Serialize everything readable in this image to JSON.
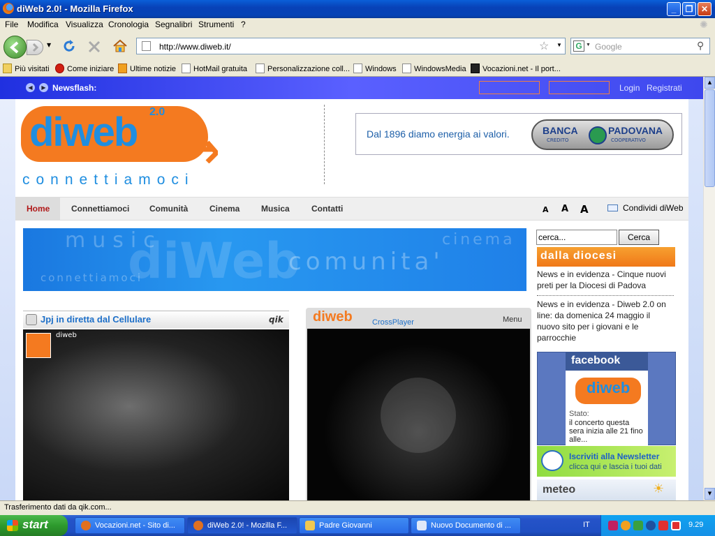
{
  "window": {
    "title": "diWeb 2.0! - Mozilla Firefox"
  },
  "menubar": [
    "File",
    "Modifica",
    "Visualizza",
    "Cronologia",
    "Segnalibri",
    "Strumenti",
    "?"
  ],
  "nav": {
    "url": "http://www.diweb.it/",
    "search_placeholder": "Google"
  },
  "bookmarks": [
    "Più visitati",
    "Come iniziare",
    "Ultime notizie",
    "HotMail gratuita",
    "Personalizzazione coll...",
    "Windows",
    "WindowsMedia",
    "Vocazioni.net - Il port..."
  ],
  "page": {
    "newsflash_label": "Newsflash:",
    "login": "Login",
    "register": "Registrati",
    "logo_main": "diweb",
    "logo_version": "2.0",
    "logo_tagline": "connettiamoci",
    "ad_text": "Dal 1896 diamo energia ai valori.",
    "ad_brand_1": "BANCA",
    "ad_brand_2": "PADOVANA",
    "ad_sub_1": "CREDITO",
    "ad_sub_2": "COOPERATIVO",
    "menu": [
      "Home",
      "Connettiamoci",
      "Comunità",
      "Cinema",
      "Musica",
      "Contatti"
    ],
    "fontsize": [
      "A",
      "A",
      "A"
    ],
    "share": "Condividi diWeb",
    "search_value": "cerca...",
    "search_button": "Cerca",
    "diocese_header": "dalla diocesi",
    "news": [
      "News e in evidenza - Cinque nuovi preti per la Diocesi di Padova",
      "News e in evidenza - Diweb 2.0 on line: da domenica 24 maggio il nuovo sito per i giovani e le parrocchie"
    ],
    "banner_words": [
      "music",
      "cinema",
      "comunita'",
      "connettiamoci"
    ],
    "banner_logo": "diWeb",
    "qik_title": "Jpj in diretta dal Cellulare",
    "qik_brand": "qik",
    "qik_user": "diweb",
    "player_logo": "diweb",
    "player_name": "CrossPlayer",
    "player_menu": "Menu",
    "facebook_title": "facebook",
    "facebook_status_label": "Stato:",
    "facebook_status": "il concerto questa sera inizia alle 21 fino alle...",
    "newsletter_title": "Iscriviti alla Newsletter",
    "newsletter_sub": "clicca qui e lascia i tuoi dati",
    "meteo": "meteo"
  },
  "status": "Trasferimento dati da qik.com...",
  "taskbar": {
    "start": "start",
    "tasks": [
      "Vocazioni.net - Sito di...",
      "diWeb 2.0! - Mozilla F...",
      "Padre Giovanni",
      "Nuovo Documento di ..."
    ],
    "lang": "IT",
    "clock": "9.29"
  },
  "colors": {
    "accent_orange": "#f47a20",
    "diweb_blue": "#1f8ee0",
    "newsflash_blue": "#3e48ee"
  }
}
